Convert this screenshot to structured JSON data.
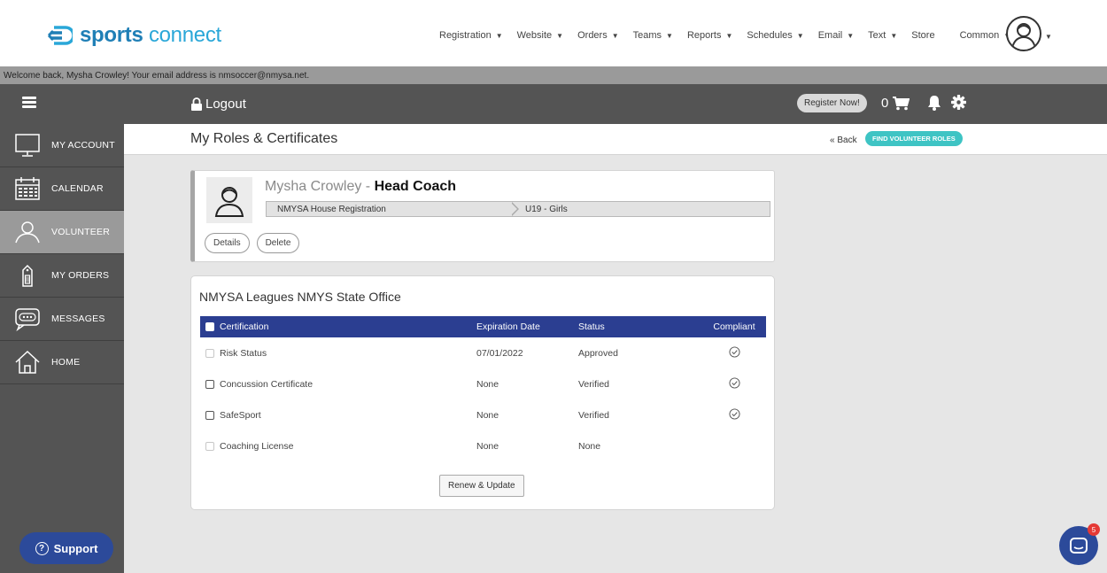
{
  "brand": {
    "name_bold": "sports",
    "name_light": "connect"
  },
  "nav": {
    "items": [
      {
        "label": "Registration",
        "caret": true
      },
      {
        "label": "Website",
        "caret": true
      },
      {
        "label": "Orders",
        "caret": true
      },
      {
        "label": "Teams",
        "caret": true
      },
      {
        "label": "Reports",
        "caret": true
      },
      {
        "label": "Schedules",
        "caret": true
      },
      {
        "label": "Email",
        "caret": true
      },
      {
        "label": "Text",
        "caret": true
      },
      {
        "label": "Store",
        "caret": false
      },
      {
        "label": "Common",
        "caret": true
      }
    ]
  },
  "welcome": "Welcome back, Mysha Crowley! Your email address is nmsoccer@nmysa.net.",
  "toolbar": {
    "logout": "Logout",
    "register": "Register Now!",
    "cart_count": "0"
  },
  "sidebar": {
    "items": [
      {
        "label": "MY ACCOUNT",
        "icon": "monitor-icon"
      },
      {
        "label": "CALENDAR",
        "icon": "calendar-icon"
      },
      {
        "label": "VOLUNTEER",
        "icon": "person-icon"
      },
      {
        "label": "MY ORDERS",
        "icon": "tag-icon"
      },
      {
        "label": "MESSAGES",
        "icon": "chat-icon"
      },
      {
        "label": "HOME",
        "icon": "home-icon"
      }
    ],
    "support": "Support"
  },
  "page": {
    "title": "My Roles & Certificates",
    "back": "« Back",
    "find": "FIND VOLUNTEER ROLES"
  },
  "role": {
    "person": "Mysha Crowley",
    "separator": " - ",
    "title": "Head Coach",
    "crumbs": [
      "NMYSA House Registration",
      "U19 - Girls"
    ],
    "details": "Details",
    "delete": "Delete"
  },
  "league": {
    "title": "NMYSA Leagues NMYS State Office",
    "headers": {
      "certification": "Certification",
      "expiration": "Expiration Date",
      "status": "Status",
      "compliant": "Compliant"
    },
    "rows": [
      {
        "cert": "Risk Status",
        "exp": "07/01/2022",
        "status": "Approved",
        "compliant": true,
        "disabled": true
      },
      {
        "cert": "Concussion Certificate",
        "exp": "None",
        "status": "Verified",
        "compliant": true,
        "disabled": false
      },
      {
        "cert": "SafeSport",
        "exp": "None",
        "status": "Verified",
        "compliant": true,
        "disabled": false
      },
      {
        "cert": "Coaching License",
        "exp": "None",
        "status": "None",
        "compliant": false,
        "disabled": true
      }
    ],
    "renew": "Renew & Update"
  },
  "chat": {
    "badge": "5"
  },
  "colors": {
    "primary": "#2b3e91",
    "teal": "#3ec4c4",
    "sidebar": "#545454",
    "brand": "#2aa7d8"
  }
}
